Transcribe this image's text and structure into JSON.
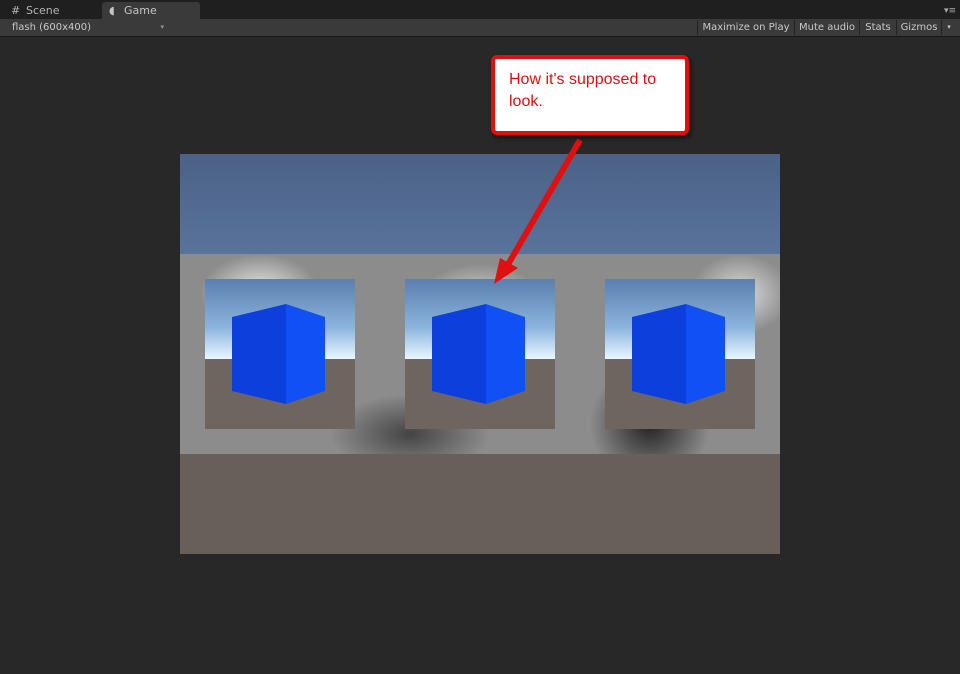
{
  "tabs": [
    {
      "label": "Scene",
      "icon": "scene-grid-icon"
    },
    {
      "label": "Game",
      "icon": "game-pacman-icon"
    }
  ],
  "toolbar": {
    "resolution": "flash (600x400)",
    "maximize": "Maximize on Play",
    "mute": "Mute audio",
    "stats": "Stats",
    "gizmos": "Gizmos"
  },
  "callout": {
    "text": "How it's supposed to look."
  },
  "cube_color": "#0d4ff5",
  "accent_red": "#e01010"
}
